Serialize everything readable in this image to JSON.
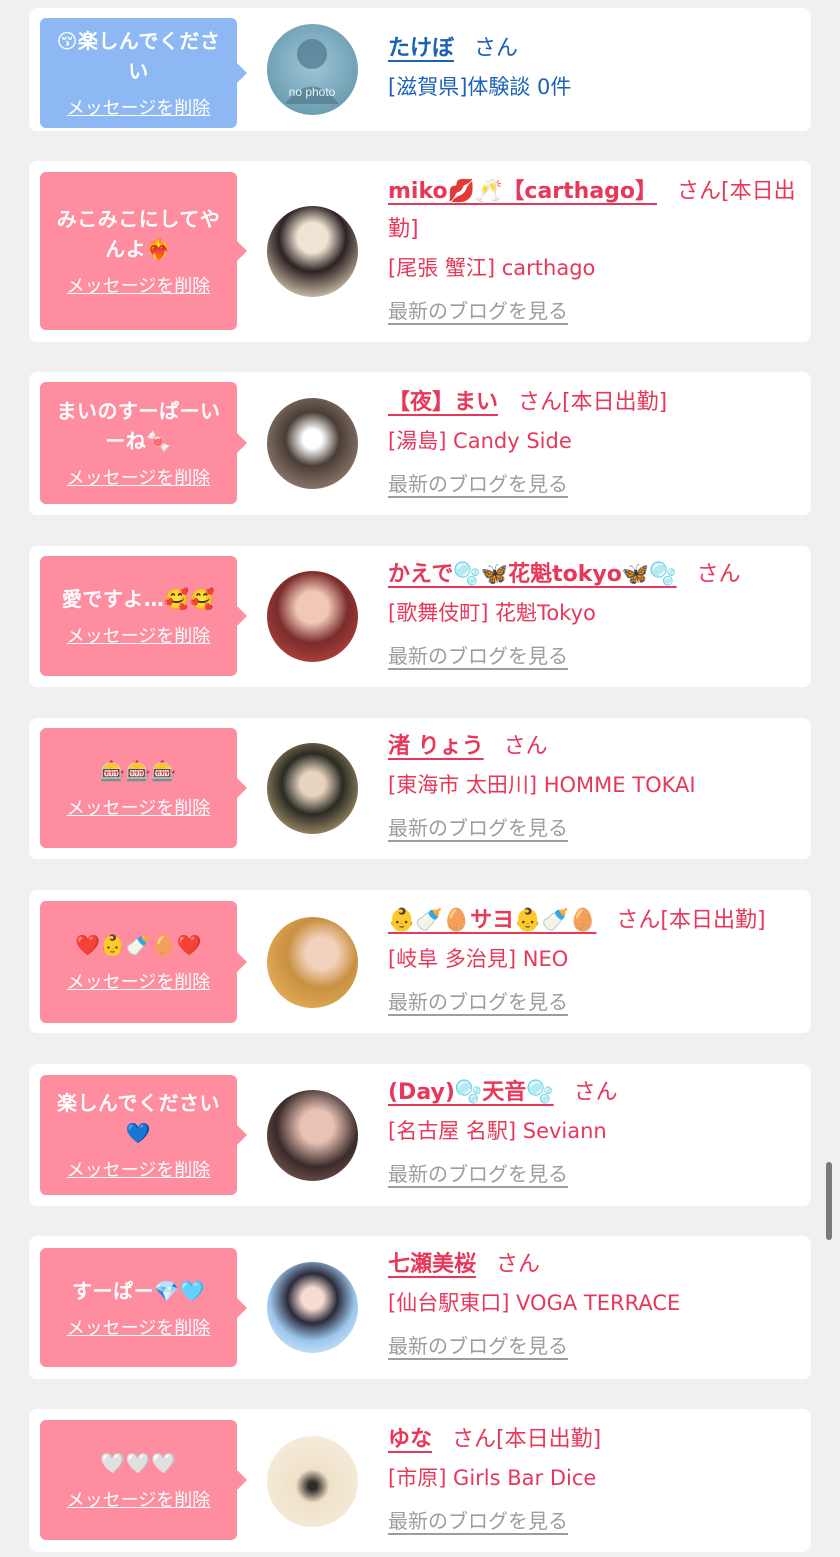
{
  "delete_label": "メッセージを削除",
  "blog_label": "最新のブログを見る",
  "colors": {
    "pink": "#fe8da0",
    "blue": "#8db8f3",
    "pink_text": "#e8385a",
    "blue_text": "#1b62b7"
  },
  "items": [
    {
      "message": "😚楽しんでください",
      "name": "たけぼ",
      "suffix": "さん",
      "shop": "[滋賀県]体験談 0件",
      "avatar_label": "no photo"
    },
    {
      "message": "みこみこにしてやんよ❤️‍🔥",
      "name": "miko💋🥂【carthago】",
      "suffix": "さん[本日出勤]",
      "shop": "[尾張 蟹江] carthago"
    },
    {
      "message": "まいのすーぱーいーね🍬",
      "name": "【夜】まい",
      "suffix": "さん[本日出勤]",
      "shop": "[湯島] Candy Side"
    },
    {
      "message": "愛ですよ…🥰🥰",
      "name": "かえで🫧🦋花魁tokyo🦋🫧",
      "suffix": "さん",
      "shop": "[歌舞伎町] 花魁Tokyo"
    },
    {
      "message": "🎰🎰🎰",
      "name": "渚 りょう",
      "suffix": "さん",
      "shop": "[東海市 太田川] HOMME TOKAI"
    },
    {
      "message": "❤️👶🍼🥚❤️",
      "name": "👶🍼🥚サヨ👶🍼🥚",
      "suffix": "さん[本日出勤]",
      "shop": "[岐阜 多治見] NEO"
    },
    {
      "message": "楽しんでください💙",
      "name": "(Day)🫧天音🫧",
      "suffix": "さん",
      "shop": "[名古屋 名駅] Seviann"
    },
    {
      "message": "すーぱー💎🩵",
      "name": "七瀬美桜",
      "suffix": "さん",
      "shop": "[仙台駅東口] VOGA TERRACE"
    },
    {
      "message": "🤍🤍🤍",
      "name": "ゆな",
      "suffix": "さん[本日出勤]",
      "shop": "[市原] Girls Bar Dice"
    }
  ]
}
